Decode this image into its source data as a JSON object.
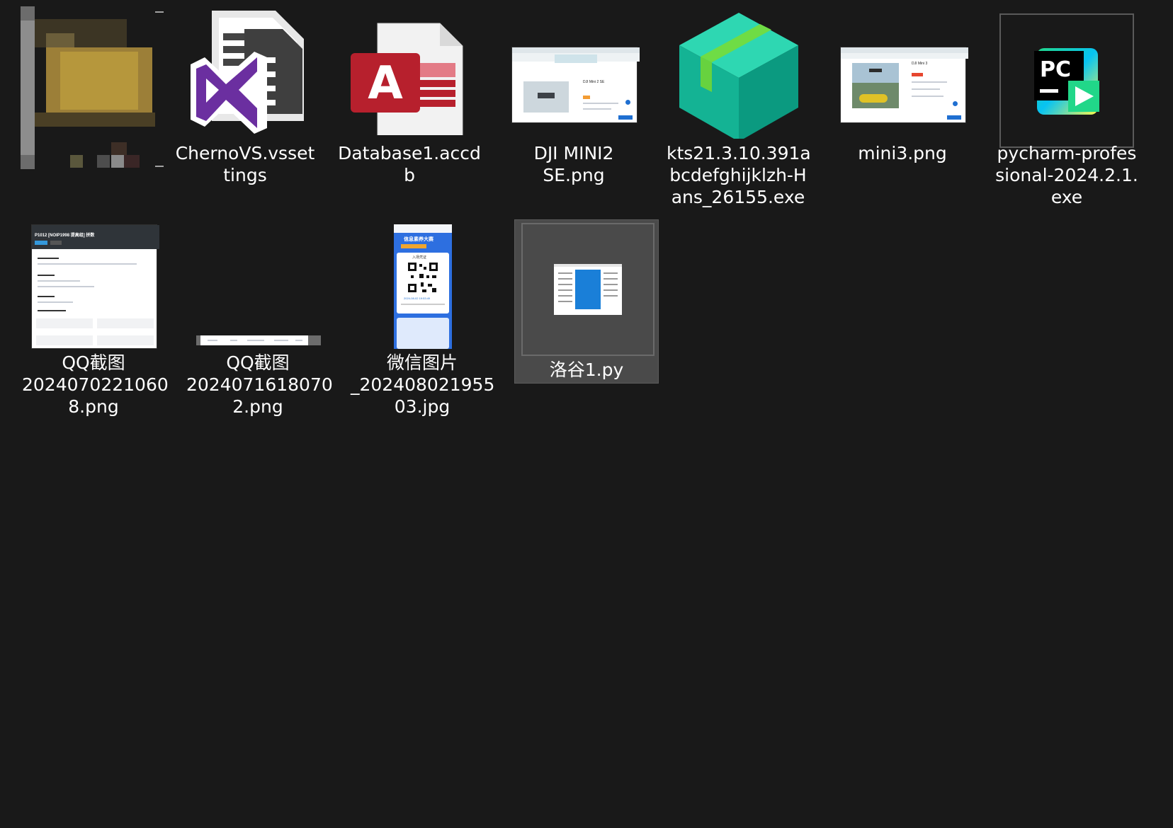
{
  "window": {
    "view": "large-icons"
  },
  "items": [
    {
      "name": "",
      "icon": "blurred-folder-icon",
      "kind": "folder"
    },
    {
      "name": "ChernoVS.vsset\ntings",
      "icon": "visual-studio-settings-icon"
    },
    {
      "name": "Database1.accd\nb",
      "icon": "access-database-icon"
    },
    {
      "name": "DJI MINI2\nSE.png",
      "icon": "image-thumbnail"
    },
    {
      "name": "kts21.3.10.391a\nbcdefghijklzh-H\nans_26155.exe",
      "icon": "package-box-icon"
    },
    {
      "name": "mini3.png",
      "icon": "image-thumbnail"
    },
    {
      "name": "pycharm-profes\nsional-2024.2.1.\nexe",
      "icon": "pycharm-icon"
    },
    {
      "name": "QQ截图\n2024070221060\n8.png",
      "icon": "image-thumbnail"
    },
    {
      "name": "QQ截图\n2024071618070\n2.png",
      "icon": "image-thumbnail"
    },
    {
      "name": "微信图片\n_202408021955\n03.jpg",
      "icon": "image-thumbnail"
    },
    {
      "name": "洛谷1.py",
      "icon": "python-file-icon",
      "selected": true
    }
  ],
  "thumb_text": {
    "qq1_title": "P1012 [NOIP1998 提高组] 拼数",
    "wx_header": "信息素养大赛",
    "wx_pass": "入场凭证",
    "wx_time": "2024-08-02 19:53:49",
    "drone1_title": "DJI Mini 2 SE",
    "drone2_title": "DJI Mini 3"
  },
  "colors": {
    "background": "#191919",
    "selection": "#4a4a4a",
    "access_red": "#b7202d",
    "vs_purple": "#6b2fa0",
    "box_teal": "#0b9a80",
    "pycharm_green": "#21d789"
  }
}
